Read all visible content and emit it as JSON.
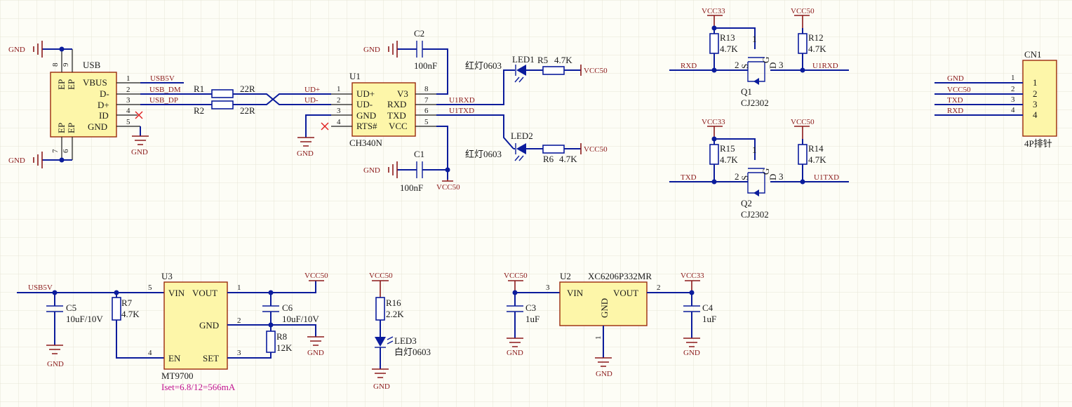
{
  "colors": {
    "wire": "#0b1c9c",
    "power": "#8b1a1a",
    "component_body": "#fdf6a9",
    "component_border": "#9a2a0c",
    "note": "#c0118f",
    "no_connect": "#e02020"
  },
  "nets": {
    "gnd": "GND",
    "vcc50": "VCC50",
    "vcc33": "VCC33",
    "usb5v": "USB5V",
    "usb_dm": "USB_DM",
    "usb_dp": "USB_DP",
    "ud_plus": "UD+",
    "ud_minus": "UD-",
    "u1rxd": "U1RXD",
    "u1txd": "U1TXD",
    "rxd": "RXD",
    "txd": "TXD"
  },
  "usb": {
    "ref": "USB",
    "pins": [
      "VBUS",
      "D-",
      "D+",
      "ID",
      "GND"
    ],
    "pin_numbers": [
      "1",
      "2",
      "3",
      "4",
      "5"
    ],
    "shield_label": "EP",
    "shield_numbers": [
      "8",
      "9",
      "7",
      "6"
    ]
  },
  "r1": {
    "ref": "R1",
    "value": "22R"
  },
  "r2": {
    "ref": "R2",
    "value": "22R"
  },
  "u1": {
    "ref": "U1",
    "part": "CH340N",
    "left_pins": [
      "UD+",
      "UD-",
      "GND",
      "RTS#"
    ],
    "left_numbers": [
      "1",
      "2",
      "3",
      "4"
    ],
    "right_pins": [
      "V3",
      "RXD",
      "TXD",
      "VCC"
    ],
    "right_numbers": [
      "8",
      "7",
      "6",
      "5"
    ]
  },
  "c2": {
    "ref": "C2",
    "value": "100nF"
  },
  "c1": {
    "ref": "C1",
    "value": "100nF"
  },
  "led1": {
    "ref": "LED1",
    "desc": "红灯0603"
  },
  "led2": {
    "ref": "LED2",
    "desc": "红灯0603"
  },
  "r5": {
    "ref": "R5",
    "value": "4.7K"
  },
  "r6": {
    "ref": "R6",
    "value": "4.7K"
  },
  "q1": {
    "ref": "Q1",
    "part": "CJ2302",
    "pins": [
      "1",
      "2",
      "3"
    ]
  },
  "q2": {
    "ref": "Q2",
    "part": "CJ2302",
    "pins": [
      "1",
      "2",
      "3"
    ]
  },
  "mos_pins": {
    "s": "S",
    "g": "G",
    "d": "D"
  },
  "r13": {
    "ref": "R13",
    "value": "4.7K"
  },
  "r12": {
    "ref": "R12",
    "value": "4.7K"
  },
  "r15": {
    "ref": "R15",
    "value": "4.7K"
  },
  "r14": {
    "ref": "R14",
    "value": "4.7K"
  },
  "cn1": {
    "ref": "CN1",
    "desc": "4P排针",
    "nets": [
      "GND",
      "VCC50",
      "TXD",
      "RXD"
    ],
    "pins": [
      "1",
      "2",
      "3",
      "4"
    ]
  },
  "u3": {
    "ref": "U3",
    "part": "MT9700",
    "note": "Iset=6.8/12=566mA",
    "pins": [
      "VIN",
      "VOUT",
      "GND",
      "EN",
      "SET"
    ],
    "numbers": [
      "5",
      "1",
      "2",
      "4",
      "3"
    ]
  },
  "c5": {
    "ref": "C5",
    "value": "10uF/10V"
  },
  "r7": {
    "ref": "R7",
    "value": "4.7K"
  },
  "c6": {
    "ref": "C6",
    "value": "10uF/10V"
  },
  "r8": {
    "ref": "R8",
    "value": "12K"
  },
  "r16": {
    "ref": "R16",
    "value": "2.2K"
  },
  "led3": {
    "ref": "LED3",
    "desc": "白灯0603"
  },
  "u2": {
    "ref": "U2",
    "part": "XC6206P332MR",
    "pins": [
      "VIN",
      "VOUT",
      "GND"
    ],
    "numbers": [
      "3",
      "2",
      "1"
    ]
  },
  "c3": {
    "ref": "C3",
    "value": "1uF"
  },
  "c4": {
    "ref": "C4",
    "value": "1uF"
  }
}
